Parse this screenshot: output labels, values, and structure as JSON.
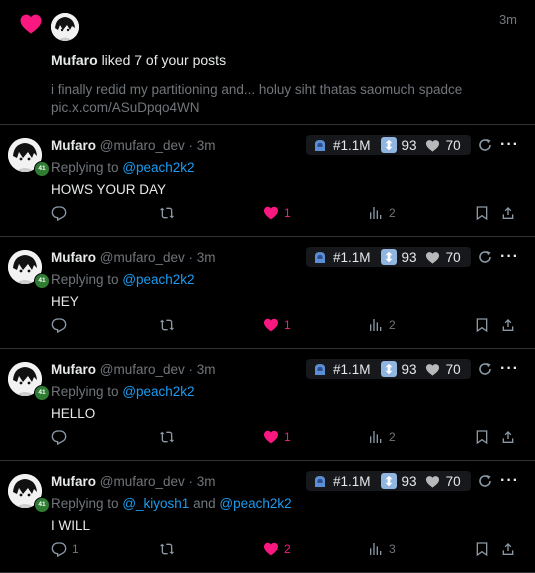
{
  "notification": {
    "time": "3m",
    "actor": "Mufaro",
    "action": "liked 7 of your posts",
    "snippet_line1": "i finally redid my partitioning and... holuy siht thatas saomuch spadce",
    "snippet_line2": "pic.x.com/ASuDpqo4WN"
  },
  "colors": {
    "like": "#f91880",
    "link": "#1d9bf0",
    "muted": "#71767b",
    "level_badge": "#2e7d32"
  },
  "posts": [
    {
      "name": "Mufaro",
      "handle": "@mufaro_dev",
      "sep": "·",
      "time": "3m",
      "level": "41",
      "replying_prefix": "Replying to",
      "mentions": "@peach2k2",
      "mentions_joiner": "",
      "mentions2": "",
      "text": "HOWS YOUR DAY",
      "rank": "#1.1M",
      "boosts": "93",
      "hearts": "70",
      "replies": "",
      "reposts": "",
      "likes": "1",
      "views": "2"
    },
    {
      "name": "Mufaro",
      "handle": "@mufaro_dev",
      "sep": "·",
      "time": "3m",
      "level": "41",
      "replying_prefix": "Replying to",
      "mentions": "@peach2k2",
      "mentions_joiner": "",
      "mentions2": "",
      "text": "HEY",
      "rank": "#1.1M",
      "boosts": "93",
      "hearts": "70",
      "replies": "",
      "reposts": "",
      "likes": "1",
      "views": "2"
    },
    {
      "name": "Mufaro",
      "handle": "@mufaro_dev",
      "sep": "·",
      "time": "3m",
      "level": "41",
      "replying_prefix": "Replying to",
      "mentions": "@peach2k2",
      "mentions_joiner": "",
      "mentions2": "",
      "text": "HELLO",
      "rank": "#1.1M",
      "boosts": "93",
      "hearts": "70",
      "replies": "",
      "reposts": "",
      "likes": "1",
      "views": "2"
    },
    {
      "name": "Mufaro",
      "handle": "@mufaro_dev",
      "sep": "·",
      "time": "3m",
      "level": "41",
      "replying_prefix": "Replying to",
      "mentions": "@_kiyosh1",
      "mentions_joiner": "and",
      "mentions2": "@peach2k2",
      "text": "I WILL",
      "rank": "#1.1M",
      "boosts": "93",
      "hearts": "70",
      "replies": "1",
      "reposts": "",
      "likes": "2",
      "views": "3"
    }
  ]
}
